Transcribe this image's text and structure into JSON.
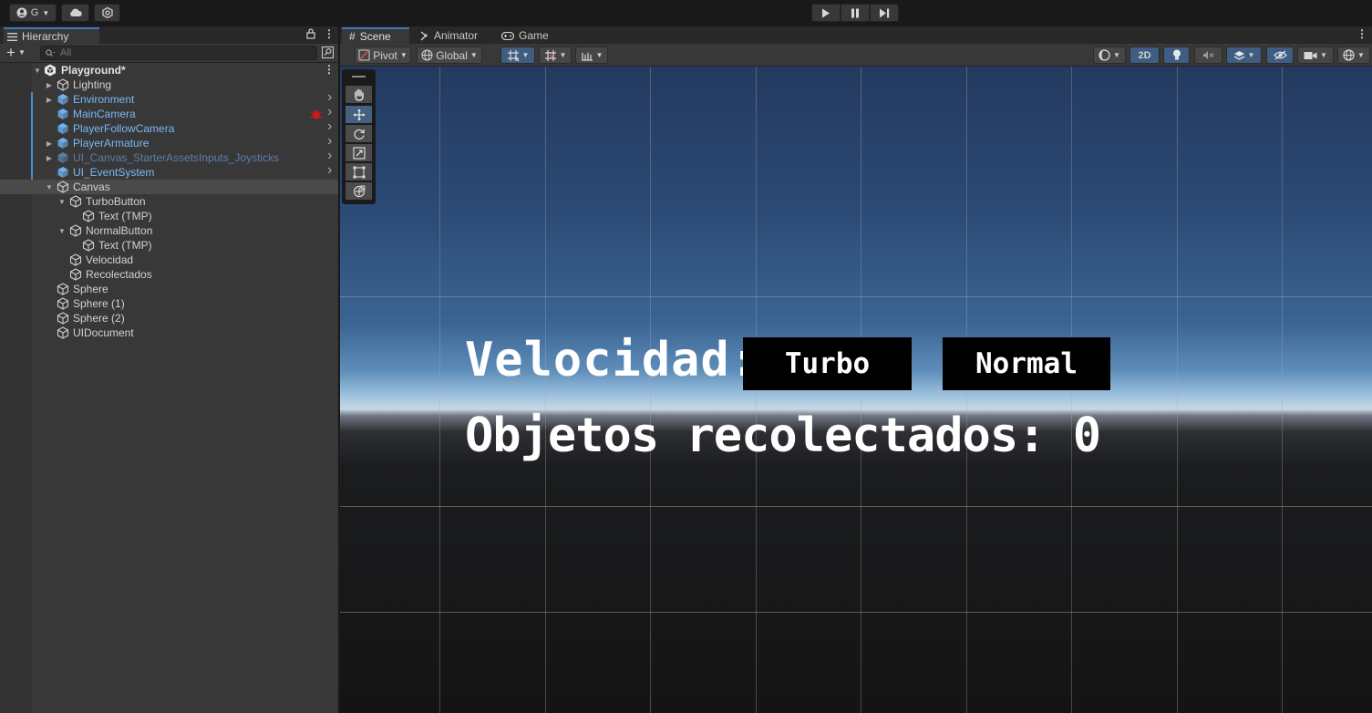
{
  "topbar": {
    "account_label": "G",
    "play_controls": [
      "play-icon",
      "pause-icon",
      "step-icon"
    ]
  },
  "hierarchy": {
    "tab_label": "Hierarchy",
    "search_placeholder": "All",
    "scene_name": "Playground*",
    "items": [
      {
        "label": "Lighting",
        "depth": 1,
        "fold": "collapsed",
        "type": "object"
      },
      {
        "label": "Environment",
        "depth": 1,
        "fold": "collapsed",
        "type": "prefab"
      },
      {
        "label": "MainCamera",
        "depth": 1,
        "fold": "none",
        "type": "prefab"
      },
      {
        "label": "PlayerFollowCamera",
        "depth": 1,
        "fold": "none",
        "type": "prefab"
      },
      {
        "label": "PlayerArmature",
        "depth": 1,
        "fold": "collapsed",
        "type": "prefab"
      },
      {
        "label": "UI_Canvas_StarterAssetsInputs_Joysticks",
        "depth": 1,
        "fold": "collapsed",
        "type": "prefab-dim"
      },
      {
        "label": "UI_EventSystem",
        "depth": 1,
        "fold": "none",
        "type": "prefab"
      },
      {
        "label": "Canvas",
        "depth": 1,
        "fold": "expanded",
        "type": "object",
        "selected": true
      },
      {
        "label": "TurboButton",
        "depth": 2,
        "fold": "expanded",
        "type": "object"
      },
      {
        "label": "Text (TMP)",
        "depth": 3,
        "fold": "none",
        "type": "object"
      },
      {
        "label": "NormalButton",
        "depth": 2,
        "fold": "expanded",
        "type": "object"
      },
      {
        "label": "Text (TMP)",
        "depth": 3,
        "fold": "none",
        "type": "object"
      },
      {
        "label": "Velocidad",
        "depth": 2,
        "fold": "none",
        "type": "object"
      },
      {
        "label": "Recolectados",
        "depth": 2,
        "fold": "none",
        "type": "object"
      },
      {
        "label": "Sphere",
        "depth": 1,
        "fold": "none",
        "type": "object"
      },
      {
        "label": "Sphere (1)",
        "depth": 1,
        "fold": "none",
        "type": "object"
      },
      {
        "label": "Sphere (2)",
        "depth": 1,
        "fold": "none",
        "type": "object"
      },
      {
        "label": "UIDocument",
        "depth": 1,
        "fold": "none",
        "type": "object"
      }
    ]
  },
  "scene_tabs": [
    {
      "label": "Scene",
      "icon": "grid-icon",
      "active": true
    },
    {
      "label": "Animator",
      "icon": "animator-icon",
      "active": false
    },
    {
      "label": "Game",
      "icon": "gamepad-icon",
      "active": false
    }
  ],
  "scene_toolbar": {
    "pivot_label": "Pivot",
    "global_label": "Global",
    "mode_2d_label": "2D"
  },
  "game_ui": {
    "velocity_label": "Velocidad:",
    "turbo_button": "Turbo",
    "normal_button": "Normal",
    "collected_label": "Objetos recolectados: 0"
  }
}
